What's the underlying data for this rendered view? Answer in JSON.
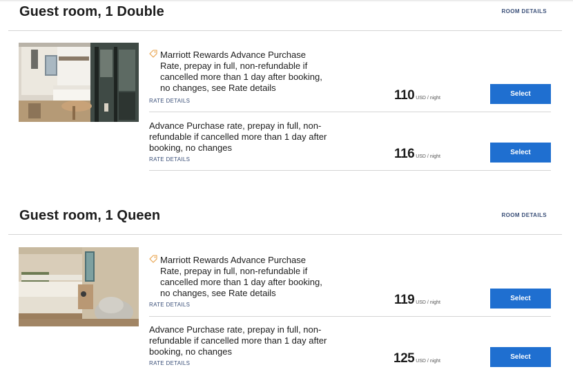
{
  "rooms": [
    {
      "title": "Guest room, 1 Double",
      "room_details_label": "ROOM DETAILS",
      "rates": [
        {
          "description": "Marriott Rewards Advance Purchase Rate, prepay in full, non-refundable if cancelled more than 1 day after booking, no changes, see Rate details",
          "rate_details_label": "RATE DETAILS",
          "price": "110",
          "unit": "USD / night",
          "select_label": "Select"
        },
        {
          "description": "Advance Purchase rate, prepay in full, non-refundable if cancelled more than 1 day after booking, no changes",
          "rate_details_label": "RATE DETAILS",
          "price": "116",
          "unit": "USD / night",
          "select_label": "Select"
        }
      ]
    },
    {
      "title": "Guest room, 1 Queen",
      "room_details_label": "ROOM DETAILS",
      "rates": [
        {
          "description": "Marriott Rewards Advance Purchase Rate, prepay in full, non-refundable if cancelled more than 1 day after booking, no changes, see Rate details",
          "rate_details_label": "RATE DETAILS",
          "price": "119",
          "unit": "USD / night",
          "select_label": "Select"
        },
        {
          "description": "Advance Purchase rate, prepay in full, non-refundable if cancelled more than 1 day after booking, no changes",
          "rate_details_label": "RATE DETAILS",
          "price": "125",
          "unit": "USD / night",
          "select_label": "Select"
        }
      ]
    }
  ],
  "icons": {
    "member_rate": "tag-icon"
  },
  "colors": {
    "select_button": "#1f6fd0",
    "link": "#3a4f78",
    "tag_icon": "#e8a24a"
  }
}
